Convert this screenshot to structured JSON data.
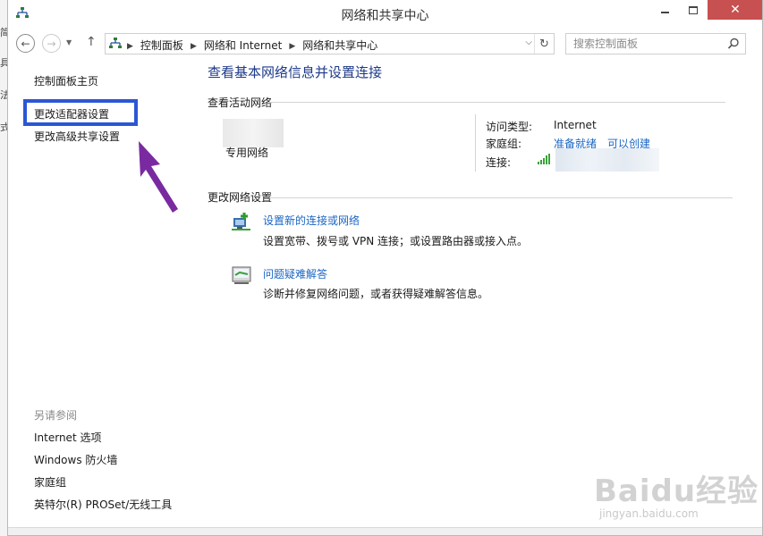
{
  "window": {
    "title": "网络和共享中心"
  },
  "nav": {
    "back_glyph": "←",
    "fwd_glyph": "→",
    "up_glyph": "↑",
    "breadcrumbs": [
      "控制面板",
      "网络和 Internet",
      "网络和共享中心"
    ],
    "search_placeholder": "搜索控制面板"
  },
  "sidebar": {
    "home": "控制面板主页",
    "adapter": "更改适配器设置",
    "advanced": "更改高级共享设置",
    "see_also": "另请参阅",
    "links": [
      "Internet 选项",
      "Windows 防火墙",
      "家庭组",
      "英特尔(R) PROSet/无线工具"
    ]
  },
  "main": {
    "title": "查看基本网络信息并设置连接",
    "active_label": "查看活动网络",
    "network_name": "专用网络",
    "access_type_key": "访问类型:",
    "access_type_val": "Internet",
    "homegroup_key": "家庭组:",
    "homegroup_link1": "准备就绪",
    "homegroup_link2": "可以创建",
    "connection_key": "连接:",
    "change_label": "更改网络设置",
    "tasks": [
      {
        "link": "设置新的连接或网络",
        "desc": "设置宽带、拨号或 VPN 连接；或设置路由器或接入点。"
      },
      {
        "link": "问题疑难解答",
        "desc": "诊断并修复网络问题，或者获得疑难解答信息。"
      }
    ]
  },
  "watermark": {
    "text": "Baidu经验",
    "sub": "jingyan.baidu.com"
  },
  "colors": {
    "link": "#1a66c4",
    "title": "#1e3a8a",
    "highlight": "#2b57d6",
    "arrow": "#7a2aa0",
    "close": "#c75050"
  }
}
